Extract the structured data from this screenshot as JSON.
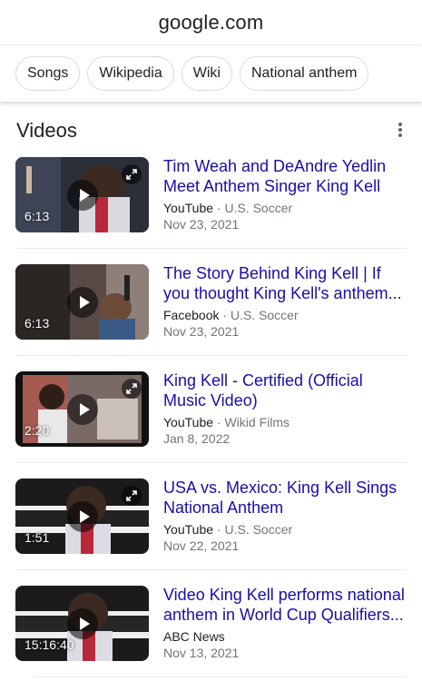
{
  "browser": {
    "url": "google.com"
  },
  "chips": [
    "Songs",
    "Wikipedia",
    "Wiki",
    "National anthem"
  ],
  "section": {
    "title": "Videos"
  },
  "videos": [
    {
      "title": "Tim Weah and DeAndre Yedlin Meet Anthem Singer King Kell",
      "platform": "YouTube",
      "separator": " · ",
      "channel": "U.S. Soccer",
      "date": "Nov 23, 2021",
      "duration": "6:13",
      "has_expand": true
    },
    {
      "title": "The Story Behind King Kell | If you thought King Kell's anthem...",
      "platform": "Facebook",
      "separator": " · ",
      "channel": "U.S. Soccer",
      "date": "Nov 23, 2021",
      "duration": "6:13",
      "has_expand": false
    },
    {
      "title": "King Kell - Certified (Official Music Video)",
      "platform": "YouTube",
      "separator": " · ",
      "channel": "Wikid Films",
      "date": "Jan 8, 2022",
      "duration": "2:20",
      "has_expand": true
    },
    {
      "title": "USA vs. Mexico: King Kell Sings National Anthem",
      "platform": "YouTube",
      "separator": " · ",
      "channel": "U.S. Soccer",
      "date": "Nov 22, 2021",
      "duration": "1:51",
      "has_expand": true
    },
    {
      "title": "Video King Kell performs national anthem in World Cup Qualifiers...",
      "platform": "ABC News",
      "separator": "",
      "channel": "",
      "date": "Nov 13, 2021",
      "duration": "15:16:40",
      "has_expand": false
    }
  ],
  "colors": {
    "link": "#1a0dab",
    "secondary": "#70757a",
    "divider": "#e8eaed"
  },
  "icons": {
    "more": "more-vert-icon",
    "play": "play-icon",
    "expand": "expand-icon"
  }
}
